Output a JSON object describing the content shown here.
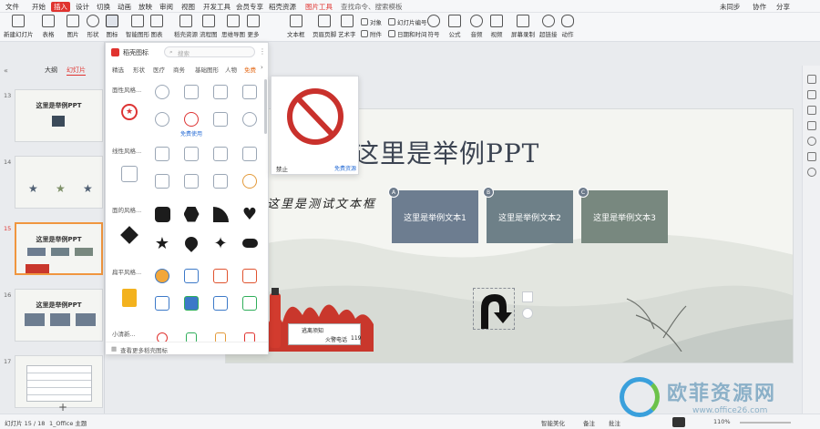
{
  "menubar": {
    "file": "文件",
    "home": "开始",
    "insert": "插入",
    "design": "设计",
    "transition": "切换",
    "animation": "动画",
    "slideshow": "放映",
    "review": "审阅",
    "view": "视图",
    "devtools": "开发工具",
    "vip": "会员专享",
    "resources": "稻壳资源",
    "drawtools": "图片工具",
    "search": "查找命令、搜索模板",
    "unsynced": "未同步",
    "collab": "协作",
    "share": "分享"
  },
  "ribbon": {
    "new_slide": "新建幻灯片",
    "table": "表格",
    "picture": "图片",
    "shape": "形状",
    "icon": "图标",
    "smartart": "智能图形",
    "chart": "图表",
    "docer_material": "稻壳资源",
    "flowchart": "流程图",
    "mindmap": "思维导图",
    "more": "更多",
    "textbox": "文本框",
    "header_footer": "页眉页脚",
    "wordart": "艺术字",
    "object": "对象",
    "slide_number": "幻灯片编号",
    "attachment": "附件",
    "datetime": "日期和时间",
    "symbol": "符号",
    "formula": "公式",
    "audio": "音频",
    "video": "视频",
    "screen_record": "屏幕录制",
    "hyperlink": "超链接",
    "action": "动作"
  },
  "left": {
    "tab_outline": "大纲",
    "tab_slides": "幻灯片",
    "slides": [
      {
        "num": "13",
        "title": "这里是举例PPT"
      },
      {
        "num": "14",
        "title": ""
      },
      {
        "num": "15",
        "title": "这里是举例PPT"
      },
      {
        "num": "16",
        "title": "这里是举例PPT"
      },
      {
        "num": "17",
        "title": ""
      }
    ]
  },
  "panel": {
    "title": "稻壳图标",
    "search_placeholder": "搜索",
    "tabs": [
      "精选",
      "形状",
      "医疗",
      "商务",
      "基础图形",
      "人物",
      "免费"
    ],
    "categories": [
      "面性风格...",
      "线性风格...",
      "面的风格...",
      "扁平风格...",
      "小清新..."
    ],
    "free_use": "免费使用",
    "footer": "查看更多稻壳图标"
  },
  "preview": {
    "name": "禁止",
    "tag": "免费资源"
  },
  "slide": {
    "title": "这里是举例PPT",
    "calligraphy": "这里是测试文本框",
    "cards": [
      {
        "badge": "A",
        "text": "这里是举例文本1",
        "color": "#6d7d90"
      },
      {
        "badge": "B",
        "text": "这里是举例文本2",
        "color": "#6e8088"
      },
      {
        "badge": "C",
        "text": "这里是举例文本3",
        "color": "#78887f"
      }
    ],
    "fire_label": "逃离须知",
    "fire_phone_label": "火警电话",
    "fire_phone": "119"
  },
  "status": {
    "slide_info": "幻灯片 15 / 18",
    "theme": "1_Office 主题",
    "smart_beautify": "智能美化",
    "notes": "备注",
    "comment": "批注",
    "zoom": "110%"
  },
  "watermark": {
    "line1": "欧菲资源网",
    "line2": "www.office26.com"
  },
  "colors": {
    "accent": "#e0332f",
    "card_a": "#6d7d90",
    "card_b": "#6e8088",
    "card_c": "#78887f"
  }
}
